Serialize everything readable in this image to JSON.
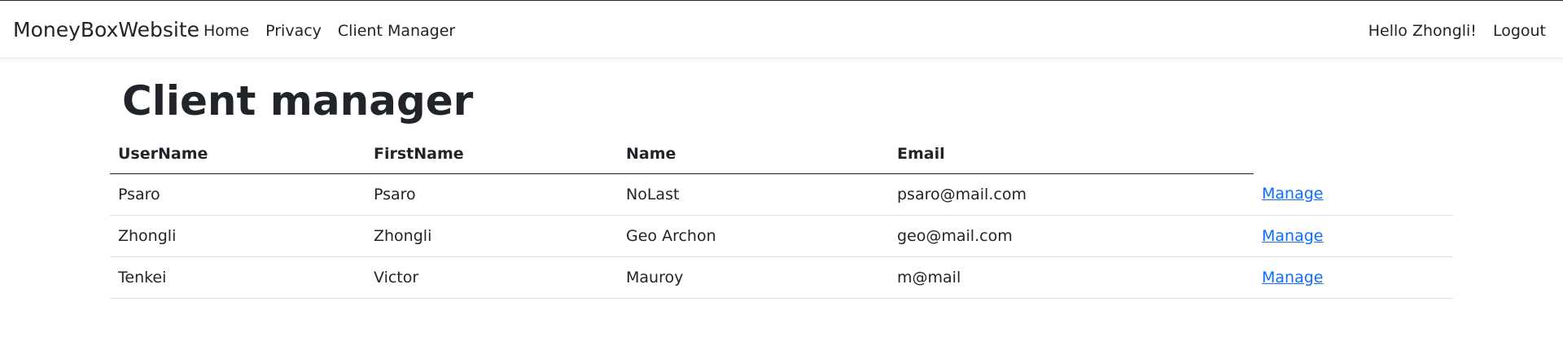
{
  "navbar": {
    "brand": "MoneyBoxWebsite",
    "links": [
      "Home",
      "Privacy",
      "Client Manager"
    ],
    "greeting": "Hello Zhongli!",
    "logout": "Logout"
  },
  "page": {
    "title": "Client manager"
  },
  "table": {
    "headers": [
      "UserName",
      "FirstName",
      "Name",
      "Email",
      ""
    ],
    "rows": [
      {
        "username": "Psaro",
        "firstname": "Psaro",
        "name": "NoLast",
        "email": "psaro@mail.com",
        "action": "Manage"
      },
      {
        "username": "Zhongli",
        "firstname": "Zhongli",
        "name": "Geo Archon",
        "email": "geo@mail.com",
        "action": "Manage"
      },
      {
        "username": "Tenkei",
        "firstname": "Victor",
        "name": "Mauroy",
        "email": "m@mail",
        "action": "Manage"
      }
    ]
  },
  "colors": {
    "text": "#212529",
    "link": "#0d6efd",
    "row_border": "#dee2e6"
  }
}
